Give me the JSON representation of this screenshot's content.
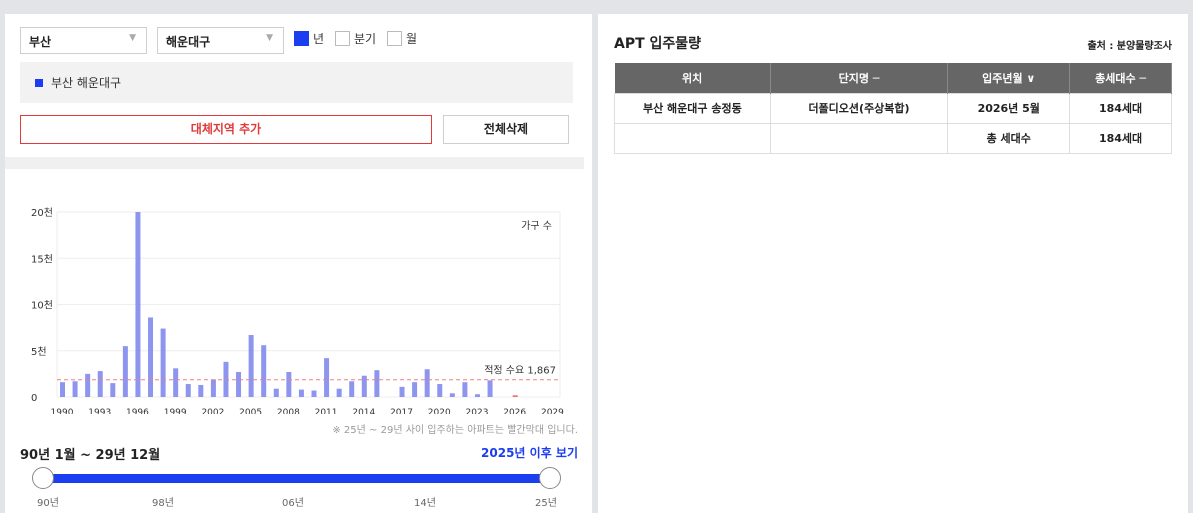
{
  "filters": {
    "city": "부산",
    "district": "해운대구",
    "period_options": [
      {
        "label": "년",
        "checked": true
      },
      {
        "label": "분기",
        "checked": false
      },
      {
        "label": "월",
        "checked": false
      }
    ]
  },
  "region_tag": "부산 해운대구",
  "buttons": {
    "add_region": "대체지역 추가",
    "delete_all": "전체삭제"
  },
  "chart_data": {
    "type": "bar",
    "legend": "가구 수",
    "y_ticks": [
      "0",
      "5천",
      "10천",
      "15천",
      "20천"
    ],
    "ylim": [
      0,
      20000
    ],
    "x_ticks": [
      "1990",
      "1993",
      "1996",
      "1999",
      "2002",
      "2005",
      "2008",
      "2011",
      "2014",
      "2017",
      "2020",
      "2023",
      "2026",
      "2029"
    ],
    "categories": [
      1990,
      1991,
      1992,
      1993,
      1994,
      1995,
      1996,
      1997,
      1998,
      1999,
      2000,
      2001,
      2002,
      2003,
      2004,
      2005,
      2006,
      2007,
      2008,
      2009,
      2010,
      2011,
      2012,
      2013,
      2014,
      2015,
      2016,
      2017,
      2018,
      2019,
      2020,
      2021,
      2022,
      2023,
      2024,
      2025,
      2026,
      2027,
      2028,
      2029
    ],
    "values": [
      1600,
      1700,
      2500,
      2800,
      1500,
      5500,
      20000,
      8600,
      7400,
      3100,
      1400,
      1300,
      1900,
      3800,
      2700,
      6700,
      5600,
      900,
      2700,
      800,
      700,
      4200,
      900,
      1700,
      2300,
      2900,
      0,
      1100,
      1600,
      3000,
      1400,
      400,
      1600,
      300,
      1800,
      0,
      184,
      0,
      0,
      0
    ],
    "reference_line": {
      "label": "적정 수요 1,867",
      "value": 1867
    }
  },
  "chart_note": "※ 25년 ~ 29년 사이 입주하는 아파트는 빨간막대 입니다.",
  "range": {
    "label": "90년 1월 ~ 29년 12월",
    "link": "2025년 이후 보기",
    "ticks": [
      "90년",
      "98년",
      "06년",
      "14년",
      "25년"
    ]
  },
  "right_panel": {
    "title": "APT 입주물량",
    "source": "출처 : 분양물량조사",
    "headers": [
      "위치",
      "단지명 ─",
      "입주년월 ∨",
      "총세대수 ─"
    ],
    "rows": [
      [
        "부산 해운대구 송정동",
        "더폴디오션(주상복합)",
        "2026년 5월",
        "184세대"
      ],
      [
        "",
        "",
        "총 세대수",
        "184세대"
      ]
    ]
  }
}
